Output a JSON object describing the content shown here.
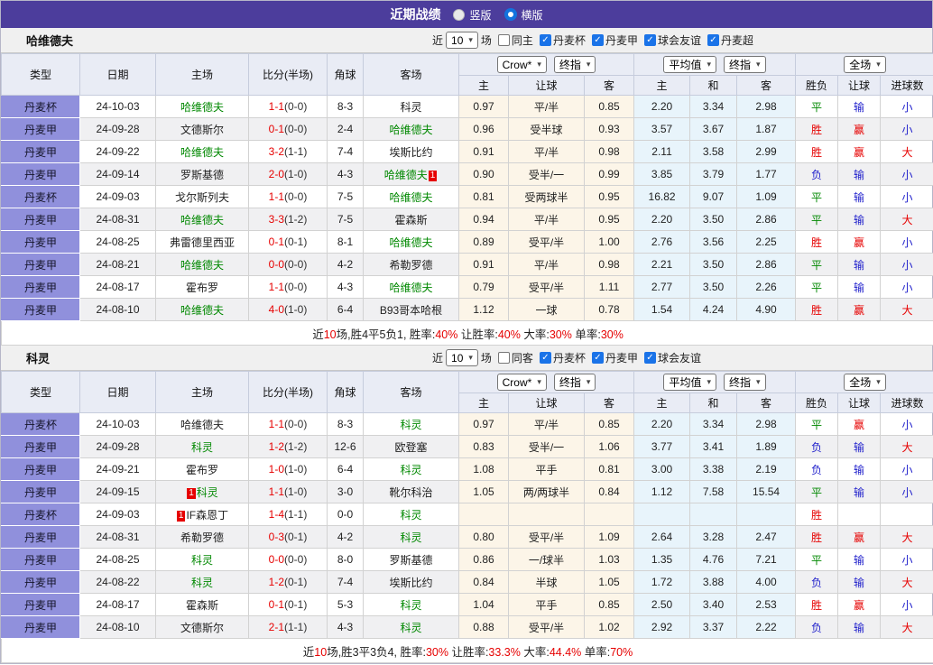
{
  "title_bar": {
    "title": "近期战绩",
    "layout_options": [
      {
        "label": "竖版",
        "selected": false
      },
      {
        "label": "横版",
        "selected": true
      }
    ]
  },
  "headers": {
    "left": [
      "类型",
      "日期",
      "主场",
      "比分(半场)",
      "角球",
      "客场"
    ],
    "odds_selects": [
      "Crow*",
      "终指"
    ],
    "odds_cols": [
      "主",
      "让球",
      "客"
    ],
    "avg_selects": [
      "平均值",
      "终指"
    ],
    "avg_cols": [
      "主",
      "和",
      "客"
    ],
    "full_select": "全场",
    "result_cols": [
      "胜负",
      "让球",
      "进球数"
    ]
  },
  "colors": {
    "accent_purple": "#4c3d9c",
    "type_cell": "#9090dc",
    "handicap_bg": "#fcf5e8",
    "average_bg": "#e8f4fb",
    "win_red": "#e60000",
    "draw_green": "#008800",
    "lose_blue": "#2222cc"
  },
  "sections": [
    {
      "team": "哈维德夫",
      "filters": {
        "prefix": "近",
        "count": "10",
        "suffix": "场",
        "same": {
          "label": "同主",
          "checked": false
        },
        "leagues": [
          {
            "label": "丹麦杯",
            "checked": true
          },
          {
            "label": "丹麦甲",
            "checked": true
          },
          {
            "label": "球会友谊",
            "checked": true
          },
          {
            "label": "丹麦超",
            "checked": true
          }
        ]
      },
      "rows": [
        {
          "type": "丹麦杯",
          "date": "24-10-03",
          "home": {
            "name": "哈维德夫",
            "green": true
          },
          "away": {
            "name": "科灵",
            "green": false
          },
          "score": "1-1",
          "half": "(0-0)",
          "corner": "8-3",
          "odds": [
            "0.97",
            "平/半",
            "0.85"
          ],
          "avg": [
            "2.20",
            "3.34",
            "2.98"
          ],
          "result": "平",
          "let": "输",
          "goal": "小"
        },
        {
          "type": "丹麦甲",
          "date": "24-09-28",
          "home": {
            "name": "文德斯尔",
            "green": false
          },
          "away": {
            "name": "哈维德夫",
            "green": true
          },
          "score": "0-1",
          "half": "(0-0)",
          "corner": "2-4",
          "odds": [
            "0.96",
            "受半球",
            "0.93"
          ],
          "avg": [
            "3.57",
            "3.67",
            "1.87"
          ],
          "result": "胜",
          "let": "赢",
          "goal": "小"
        },
        {
          "type": "丹麦甲",
          "date": "24-09-22",
          "home": {
            "name": "哈维德夫",
            "green": true
          },
          "away": {
            "name": "埃斯比约",
            "green": false
          },
          "score": "3-2",
          "half": "(1-1)",
          "corner": "7-4",
          "odds": [
            "0.91",
            "平/半",
            "0.98"
          ],
          "avg": [
            "2.11",
            "3.58",
            "2.99"
          ],
          "result": "胜",
          "let": "赢",
          "goal": "大"
        },
        {
          "type": "丹麦甲",
          "date": "24-09-14",
          "home": {
            "name": "罗斯基德",
            "green": false
          },
          "away": {
            "name": "哈维德夫",
            "green": true,
            "badge": "1",
            "badge_pos": "after"
          },
          "score": "2-0",
          "half": "(1-0)",
          "corner": "4-3",
          "odds": [
            "0.90",
            "受半/一",
            "0.99"
          ],
          "avg": [
            "3.85",
            "3.79",
            "1.77"
          ],
          "result": "负",
          "let": "输",
          "goal": "小"
        },
        {
          "type": "丹麦杯",
          "date": "24-09-03",
          "home": {
            "name": "戈尔斯列夫",
            "green": false
          },
          "away": {
            "name": "哈维德夫",
            "green": true
          },
          "score": "1-1",
          "half": "(0-0)",
          "corner": "7-5",
          "odds": [
            "0.81",
            "受两球半",
            "0.95"
          ],
          "avg": [
            "16.82",
            "9.07",
            "1.09"
          ],
          "result": "平",
          "let": "输",
          "goal": "小"
        },
        {
          "type": "丹麦甲",
          "date": "24-08-31",
          "home": {
            "name": "哈维德夫",
            "green": true
          },
          "away": {
            "name": "霍森斯",
            "green": false
          },
          "score": "3-3",
          "half": "(1-2)",
          "corner": "7-5",
          "odds": [
            "0.94",
            "平/半",
            "0.95"
          ],
          "avg": [
            "2.20",
            "3.50",
            "2.86"
          ],
          "result": "平",
          "let": "输",
          "goal": "大"
        },
        {
          "type": "丹麦甲",
          "date": "24-08-25",
          "home": {
            "name": "弗雷德里西亚",
            "green": false
          },
          "away": {
            "name": "哈维德夫",
            "green": true
          },
          "score": "0-1",
          "half": "(0-1)",
          "corner": "8-1",
          "odds": [
            "0.89",
            "受平/半",
            "1.00"
          ],
          "avg": [
            "2.76",
            "3.56",
            "2.25"
          ],
          "result": "胜",
          "let": "赢",
          "goal": "小"
        },
        {
          "type": "丹麦甲",
          "date": "24-08-21",
          "home": {
            "name": "哈维德夫",
            "green": true
          },
          "away": {
            "name": "希勒罗德",
            "green": false
          },
          "score": "0-0",
          "half": "(0-0)",
          "corner": "4-2",
          "odds": [
            "0.91",
            "平/半",
            "0.98"
          ],
          "avg": [
            "2.21",
            "3.50",
            "2.86"
          ],
          "result": "平",
          "let": "输",
          "goal": "小"
        },
        {
          "type": "丹麦甲",
          "date": "24-08-17",
          "home": {
            "name": "霍布罗",
            "green": false
          },
          "away": {
            "name": "哈维德夫",
            "green": true
          },
          "score": "1-1",
          "half": "(0-0)",
          "corner": "4-3",
          "odds": [
            "0.79",
            "受平/半",
            "1.11"
          ],
          "avg": [
            "2.77",
            "3.50",
            "2.26"
          ],
          "result": "平",
          "let": "输",
          "goal": "小"
        },
        {
          "type": "丹麦甲",
          "date": "24-08-10",
          "home": {
            "name": "哈维德夫",
            "green": true
          },
          "away": {
            "name": "B93哥本哈根",
            "green": false
          },
          "score": "4-0",
          "half": "(1-0)",
          "corner": "6-4",
          "odds": [
            "1.12",
            "一球",
            "0.78"
          ],
          "avg": [
            "1.54",
            "4.24",
            "4.90"
          ],
          "result": "胜",
          "let": "赢",
          "goal": "大"
        }
      ],
      "summary": [
        {
          "text": "近"
        },
        {
          "text": "10",
          "red": true
        },
        {
          "text": "场,胜4平5负1, 胜率:"
        },
        {
          "text": "40%",
          "red": true
        },
        {
          "text": " 让胜率:"
        },
        {
          "text": "40%",
          "red": true
        },
        {
          "text": " 大率:"
        },
        {
          "text": "30%",
          "red": true
        },
        {
          "text": " 单率:"
        },
        {
          "text": "30%",
          "red": true
        }
      ]
    },
    {
      "team": "科灵",
      "filters": {
        "prefix": "近",
        "count": "10",
        "suffix": "场",
        "same": {
          "label": "同客",
          "checked": false
        },
        "leagues": [
          {
            "label": "丹麦杯",
            "checked": true
          },
          {
            "label": "丹麦甲",
            "checked": true
          },
          {
            "label": "球会友谊",
            "checked": true
          }
        ]
      },
      "rows": [
        {
          "type": "丹麦杯",
          "date": "24-10-03",
          "home": {
            "name": "哈维德夫",
            "green": false
          },
          "away": {
            "name": "科灵",
            "green": true
          },
          "score": "1-1",
          "half": "(0-0)",
          "corner": "8-3",
          "odds": [
            "0.97",
            "平/半",
            "0.85"
          ],
          "avg": [
            "2.20",
            "3.34",
            "2.98"
          ],
          "result": "平",
          "let": "赢",
          "goal": "小"
        },
        {
          "type": "丹麦甲",
          "date": "24-09-28",
          "home": {
            "name": "科灵",
            "green": true
          },
          "away": {
            "name": "欧登塞",
            "green": false
          },
          "score": "1-2",
          "half": "(1-2)",
          "corner": "12-6",
          "odds": [
            "0.83",
            "受半/一",
            "1.06"
          ],
          "avg": [
            "3.77",
            "3.41",
            "1.89"
          ],
          "result": "负",
          "let": "输",
          "goal": "大"
        },
        {
          "type": "丹麦甲",
          "date": "24-09-21",
          "home": {
            "name": "霍布罗",
            "green": false
          },
          "away": {
            "name": "科灵",
            "green": true
          },
          "score": "1-0",
          "half": "(1-0)",
          "corner": "6-4",
          "odds": [
            "1.08",
            "平手",
            "0.81"
          ],
          "avg": [
            "3.00",
            "3.38",
            "2.19"
          ],
          "result": "负",
          "let": "输",
          "goal": "小"
        },
        {
          "type": "丹麦甲",
          "date": "24-09-15",
          "home": {
            "name": "科灵",
            "green": true,
            "badge": "1",
            "badge_pos": "before"
          },
          "away": {
            "name": "靴尔科治",
            "green": false
          },
          "score": "1-1",
          "half": "(1-0)",
          "corner": "3-0",
          "odds": [
            "1.05",
            "两/两球半",
            "0.84"
          ],
          "avg": [
            "1.12",
            "7.58",
            "15.54"
          ],
          "result": "平",
          "let": "输",
          "goal": "小"
        },
        {
          "type": "丹麦杯",
          "date": "24-09-03",
          "home": {
            "name": "IF森恩丁",
            "green": false,
            "badge": "1",
            "badge_pos": "before"
          },
          "away": {
            "name": "科灵",
            "green": true
          },
          "score": "1-4",
          "half": "(1-1)",
          "corner": "0-0",
          "odds": [
            "",
            "",
            ""
          ],
          "avg": [
            "",
            "",
            ""
          ],
          "result": "胜",
          "let": "",
          "goal": ""
        },
        {
          "type": "丹麦甲",
          "date": "24-08-31",
          "home": {
            "name": "希勒罗德",
            "green": false
          },
          "away": {
            "name": "科灵",
            "green": true
          },
          "score": "0-3",
          "half": "(0-1)",
          "corner": "4-2",
          "odds": [
            "0.80",
            "受平/半",
            "1.09"
          ],
          "avg": [
            "2.64",
            "3.28",
            "2.47"
          ],
          "result": "胜",
          "let": "赢",
          "goal": "大"
        },
        {
          "type": "丹麦甲",
          "date": "24-08-25",
          "home": {
            "name": "科灵",
            "green": true
          },
          "away": {
            "name": "罗斯基德",
            "green": false
          },
          "score": "0-0",
          "half": "(0-0)",
          "corner": "8-0",
          "odds": [
            "0.86",
            "一/球半",
            "1.03"
          ],
          "avg": [
            "1.35",
            "4.76",
            "7.21"
          ],
          "result": "平",
          "let": "输",
          "goal": "小"
        },
        {
          "type": "丹麦甲",
          "date": "24-08-22",
          "home": {
            "name": "科灵",
            "green": true
          },
          "away": {
            "name": "埃斯比约",
            "green": false
          },
          "score": "1-2",
          "half": "(0-1)",
          "corner": "7-4",
          "odds": [
            "0.84",
            "半球",
            "1.05"
          ],
          "avg": [
            "1.72",
            "3.88",
            "4.00"
          ],
          "result": "负",
          "let": "输",
          "goal": "大"
        },
        {
          "type": "丹麦甲",
          "date": "24-08-17",
          "home": {
            "name": "霍森斯",
            "green": false
          },
          "away": {
            "name": "科灵",
            "green": true
          },
          "score": "0-1",
          "half": "(0-1)",
          "corner": "5-3",
          "odds": [
            "1.04",
            "平手",
            "0.85"
          ],
          "avg": [
            "2.50",
            "3.40",
            "2.53"
          ],
          "result": "胜",
          "let": "赢",
          "goal": "小"
        },
        {
          "type": "丹麦甲",
          "date": "24-08-10",
          "home": {
            "name": "文德斯尔",
            "green": false
          },
          "away": {
            "name": "科灵",
            "green": true
          },
          "score": "2-1",
          "half": "(1-1)",
          "corner": "4-3",
          "odds": [
            "0.88",
            "受平/半",
            "1.02"
          ],
          "avg": [
            "2.92",
            "3.37",
            "2.22"
          ],
          "result": "负",
          "let": "输",
          "goal": "大"
        }
      ],
      "summary": [
        {
          "text": "近"
        },
        {
          "text": "10",
          "red": true
        },
        {
          "text": "场,胜3平3负4, 胜率:"
        },
        {
          "text": "30%",
          "red": true
        },
        {
          "text": " 让胜率:"
        },
        {
          "text": "33.3%",
          "red": true
        },
        {
          "text": " 大率:"
        },
        {
          "text": "44.4%",
          "red": true
        },
        {
          "text": " 单率:"
        },
        {
          "text": "70%",
          "red": true
        }
      ]
    }
  ]
}
